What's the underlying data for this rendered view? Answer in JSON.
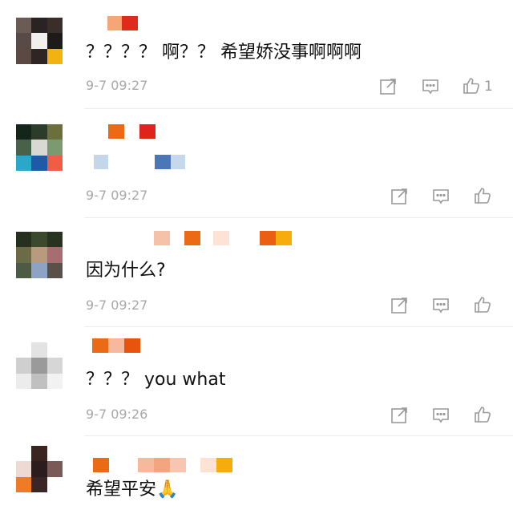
{
  "comments": [
    {
      "text": "？？？？ 啊？？ 希望娇没事啊啊啊",
      "time": "9-7 09:27",
      "likes": "1"
    },
    {
      "text": "",
      "time": "9-7 09:27",
      "likes": ""
    },
    {
      "text": "因为什么?",
      "time": "9-7 09:27",
      "likes": ""
    },
    {
      "text": "？？？ you what",
      "time": "9-7 09:26",
      "likes": ""
    },
    {
      "text": "希望平安🙏",
      "time": "",
      "likes": ""
    }
  ],
  "icons": {
    "share": "share-icon",
    "reply": "comment-icon",
    "like": "thumbs-up-icon"
  },
  "colors": {
    "time": "#a8a8a8",
    "icon": "#9a9a9a",
    "divider": "#ececec"
  }
}
